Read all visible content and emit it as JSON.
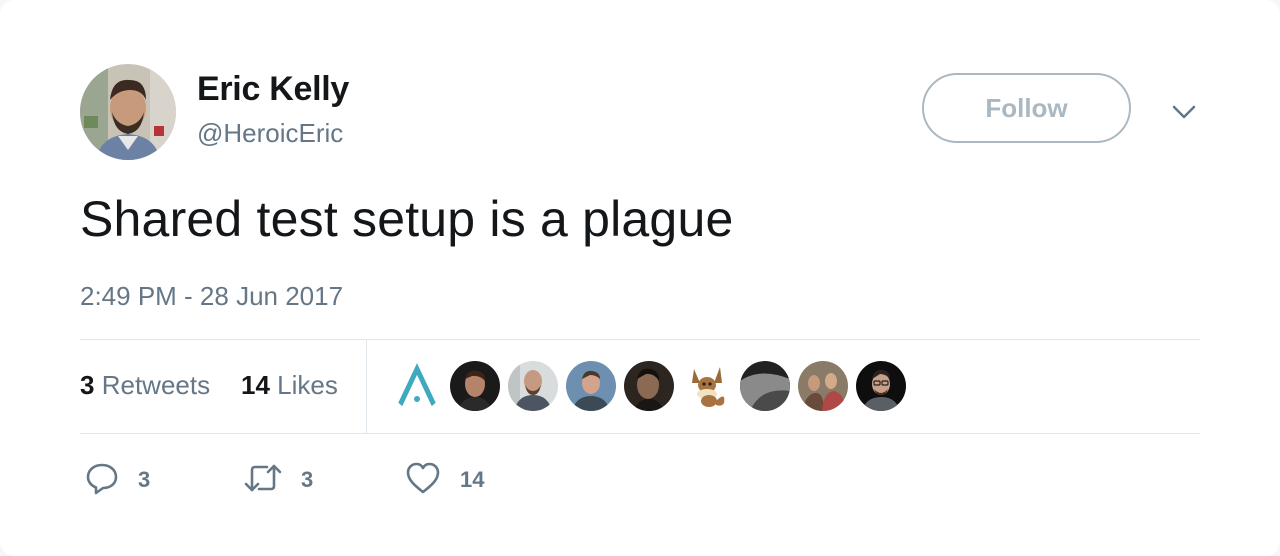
{
  "author": {
    "name": "Eric Kelly",
    "handle": "@HeroicEric"
  },
  "follow_label": "Follow",
  "tweet": {
    "text": "Shared test setup is a plague",
    "timestamp": "2:49 PM - 28 Jun 2017"
  },
  "stats": {
    "retweets_count": "3",
    "retweets_label": "Retweets",
    "likes_count": "14",
    "likes_label": "Likes"
  },
  "likers": [
    "liker-logo-avatar",
    "liker-avatar-2",
    "liker-avatar-3",
    "liker-avatar-4",
    "liker-avatar-5",
    "liker-eevee-avatar",
    "liker-avatar-7",
    "liker-avatar-8",
    "liker-avatar-9"
  ],
  "actions": {
    "reply_count": "3",
    "retweet_count": "3",
    "like_count": "14"
  },
  "colors": {
    "text": "#14171a",
    "secondary": "#657786",
    "border": "#e1e8ed",
    "follow_border": "#aab8c2",
    "logo_teal": "#3fa9bf"
  },
  "icons": [
    "reply-icon",
    "retweet-icon",
    "heart-icon",
    "chevron-down-icon"
  ]
}
